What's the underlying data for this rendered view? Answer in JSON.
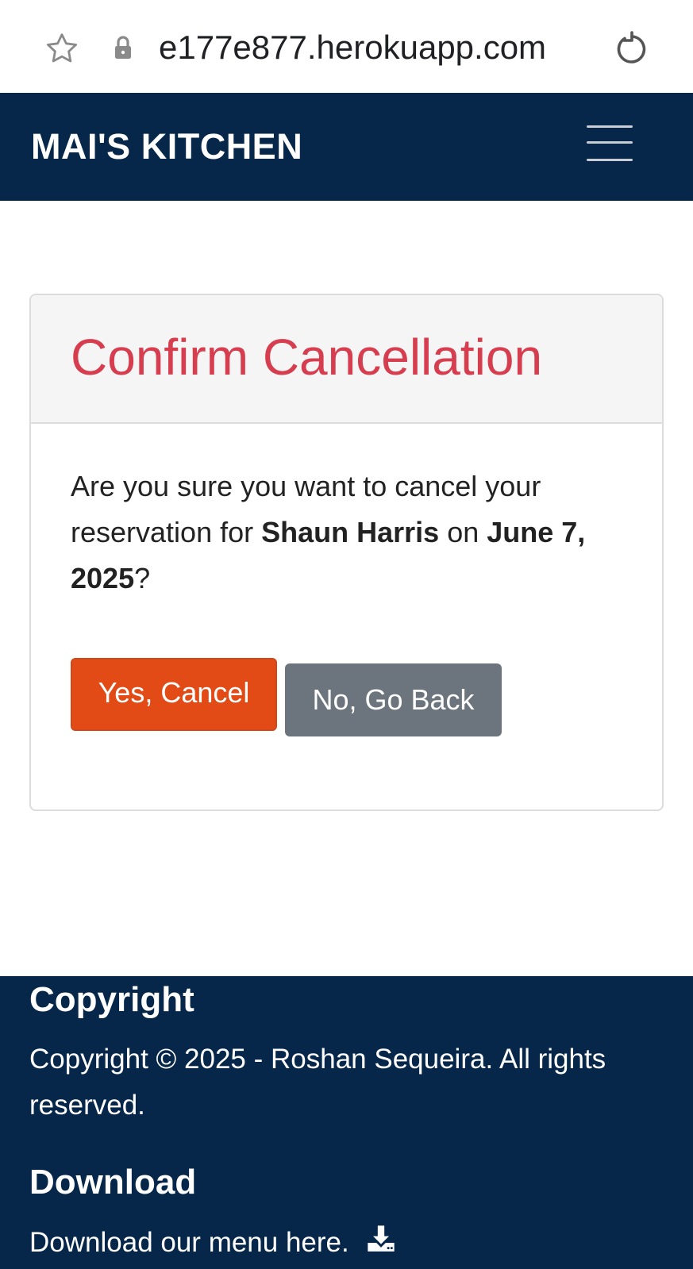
{
  "browser": {
    "url": "e177e877.herokuapp.com",
    "icons": [
      "star-icon",
      "lock-icon",
      "reload-icon"
    ]
  },
  "navbar": {
    "brand": "MAI'S KITCHEN",
    "menu_icon": "hamburger-icon",
    "background": "#062749"
  },
  "card": {
    "title": "Confirm Cancellation",
    "title_color": "#d63d4f",
    "message": {
      "prefix": "Are you sure you want to cancel your reservation for ",
      "name": "Shaun Harris",
      "middle": " on ",
      "date": "June 7, 2025",
      "suffix": "?"
    },
    "confirm_button": "Yes, Cancel",
    "back_button": "No, Go Back",
    "confirm_color": "#e34b16",
    "back_color": "#6c757d"
  },
  "footer": {
    "copyright_heading": "Copyright",
    "copyright_text": "Copyright © 2025 - Roshan Sequeira. All rights reserved.",
    "download_heading": "Download",
    "download_text": "Download our menu here.",
    "download_icon": "download-icon"
  }
}
